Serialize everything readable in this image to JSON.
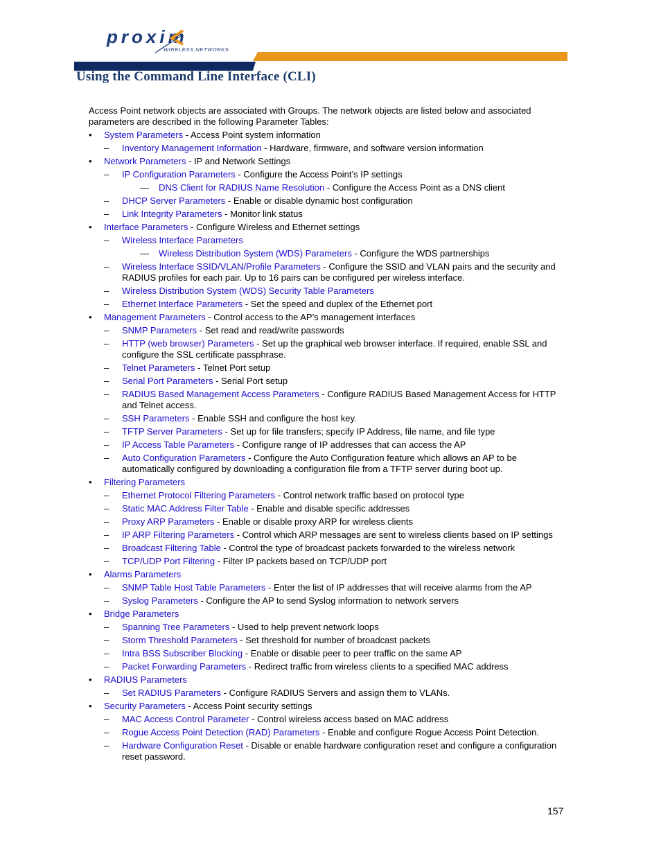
{
  "header": {
    "logo_text": "proxim",
    "logo_subtitle": "WIRELESS NETWORKS",
    "brand_colors": {
      "blue": "#0f2a62",
      "orange": "#e8961e",
      "title": "#1b3a6b",
      "link": "#1a0dcc"
    },
    "section_title": "Using the Command Line Interface (CLI)"
  },
  "intro": "Access Point network objects are associated with Groups. The network objects are listed below and associated parameters are described in the following Parameter Tables:",
  "items": [
    {
      "level": 1,
      "marker": "•",
      "link": "System Parameters",
      "desc": " - Access Point system information"
    },
    {
      "level": 2,
      "marker": "–",
      "link": "Inventory Management Information",
      "desc": " - Hardware, firmware, and software version information"
    },
    {
      "level": 1,
      "marker": "•",
      "link": "Network Parameters",
      "desc": " - IP and Network Settings"
    },
    {
      "level": 2,
      "marker": "–",
      "link": "IP Configuration Parameters",
      "desc": " - Configure the Access Point’s IP settings"
    },
    {
      "level": 3,
      "marker": "—",
      "link": "DNS Client for RADIUS Name Resolution",
      "desc": " - Configure the Access Point as a DNS client"
    },
    {
      "level": 2,
      "marker": "–",
      "link": "DHCP Server Parameters",
      "desc": " - Enable or disable dynamic host configuration"
    },
    {
      "level": 2,
      "marker": "–",
      "link": "Link Integrity Parameters",
      "desc": " - Monitor link status"
    },
    {
      "level": 1,
      "marker": "•",
      "link": "Interface Parameters",
      "desc": " - Configure Wireless and Ethernet settings"
    },
    {
      "level": 2,
      "marker": "–",
      "link": "Wireless Interface Parameters",
      "desc": ""
    },
    {
      "level": 3,
      "marker": "—",
      "link": "Wireless Distribution System (WDS) Parameters",
      "desc": " - Configure the WDS partnerships"
    },
    {
      "level": 2,
      "marker": "–",
      "link": "Wireless Interface SSID/VLAN/Profile Parameters",
      "desc": " -  Configure the SSID and VLAN pairs and the security and RADIUS profiles for each pair. Up to 16 pairs can be configured per wireless interface."
    },
    {
      "level": 2,
      "marker": "–",
      "link": "Wireless Distribution System (WDS) Security Table Parameters",
      "desc": ""
    },
    {
      "level": 2,
      "marker": "–",
      "link": "Ethernet Interface Parameters",
      "desc": " - Set the speed and duplex of the Ethernet port"
    },
    {
      "level": 1,
      "marker": "•",
      "link": "Management Parameters",
      "desc": " - Control access to the AP’s management interfaces"
    },
    {
      "level": 2,
      "marker": "–",
      "link": "SNMP Parameters",
      "desc": " - Set read and read/write passwords"
    },
    {
      "level": 2,
      "marker": "–",
      "link": "HTTP (web browser) Parameters",
      "desc": " - Set up the graphical web browser interface. If required, enable SSL and configure the SSL certificate passphrase."
    },
    {
      "level": 2,
      "marker": "–",
      "link": "Telnet Parameters",
      "desc": " - Telnet Port setup"
    },
    {
      "level": 2,
      "marker": "–",
      "link": "Serial Port Parameters",
      "desc": " - Serial Port setup"
    },
    {
      "level": 2,
      "marker": "–",
      "link": "RADIUS Based Management Access Parameters",
      "desc": " - Configure RADIUS Based Management Access for HTTP and Telnet access."
    },
    {
      "level": 2,
      "marker": "–",
      "link": "SSH Parameters",
      "desc": " - Enable SSH and configure the host key."
    },
    {
      "level": 2,
      "marker": "–",
      "link": "TFTP Server Parameters",
      "desc": " - Set up for file transfers; specify IP Address, file name, and file type"
    },
    {
      "level": 2,
      "marker": "–",
      "link": "IP Access Table Parameters",
      "desc": " - Configure range of IP addresses that can access the AP"
    },
    {
      "level": 2,
      "marker": "–",
      "link": "Auto Configuration Parameters",
      "desc": " - Configure the Auto Configuration feature which allows an AP to be automatically configured by downloading a configuration file from a TFTP server during boot up."
    },
    {
      "level": 1,
      "marker": "•",
      "link": "Filtering Parameters",
      "desc": ""
    },
    {
      "level": 2,
      "marker": "–",
      "link": "Ethernet Protocol Filtering Parameters",
      "desc": " - Control network traffic based on protocol type"
    },
    {
      "level": 2,
      "marker": "–",
      "link": "Static MAC Address Filter Table",
      "desc": " - Enable and disable specific addresses"
    },
    {
      "level": 2,
      "marker": "–",
      "link": "Proxy ARP Parameters",
      "desc": " - Enable or disable proxy ARP for wireless clients"
    },
    {
      "level": 2,
      "marker": "–",
      "link": "IP ARP Filtering Parameters",
      "desc": " - Control which ARP messages are sent to wireless clients based on IP settings"
    },
    {
      "level": 2,
      "marker": "–",
      "link": "Broadcast Filtering Table",
      "desc": " - Control the type of broadcast packets forwarded to the wireless network"
    },
    {
      "level": 2,
      "marker": "–",
      "link": "TCP/UDP Port Filtering",
      "desc": " - Filter IP packets based on TCP/UDP port"
    },
    {
      "level": 1,
      "marker": "•",
      "link": "Alarms Parameters",
      "desc": ""
    },
    {
      "level": 2,
      "marker": "–",
      "link": "SNMP Table Host Table Parameters",
      "desc": " - Enter the list of IP addresses that will receive alarms from the AP"
    },
    {
      "level": 2,
      "marker": "–",
      "link": "Syslog Parameters",
      "desc": " - Configure the AP to send Syslog information to network servers"
    },
    {
      "level": 1,
      "marker": "•",
      "link": "Bridge Parameters",
      "desc": ""
    },
    {
      "level": 2,
      "marker": "–",
      "link": "Spanning Tree Parameters",
      "desc": " - Used to help prevent network loops"
    },
    {
      "level": 2,
      "marker": "–",
      "link": "Storm Threshold Parameters",
      "desc": " - Set threshold for number of broadcast packets"
    },
    {
      "level": 2,
      "marker": "–",
      "link": "Intra BSS Subscriber Blocking",
      "desc": " - Enable or disable peer to peer traffic on the same AP"
    },
    {
      "level": 2,
      "marker": "–",
      "link": "Packet Forwarding Parameters",
      "desc": " - Redirect traffic from wireless clients to a specified MAC address"
    },
    {
      "level": 1,
      "marker": "•",
      "link": "RADIUS Parameters",
      "desc": ""
    },
    {
      "level": 2,
      "marker": "–",
      "link": "Set RADIUS Parameters",
      "desc": " - Configure RADIUS Servers and assign them to VLANs."
    },
    {
      "level": 1,
      "marker": "•",
      "link": "Security Parameters",
      "desc": " - Access Point security settings"
    },
    {
      "level": 2,
      "marker": "–",
      "link": "MAC Access Control Parameter",
      "desc": " - Control wireless access based on MAC address"
    },
    {
      "level": 2,
      "marker": "–",
      "link": "Rogue Access Point Detection (RAD) Parameters",
      "desc": " - Enable and configure Rogue Access Point Detection."
    },
    {
      "level": 2,
      "marker": "–",
      "link": "Hardware Configuration Reset",
      "desc": " - Disable or enable hardware configuration reset and configure a configuration reset password."
    }
  ],
  "footer": {
    "page_number": "157"
  }
}
